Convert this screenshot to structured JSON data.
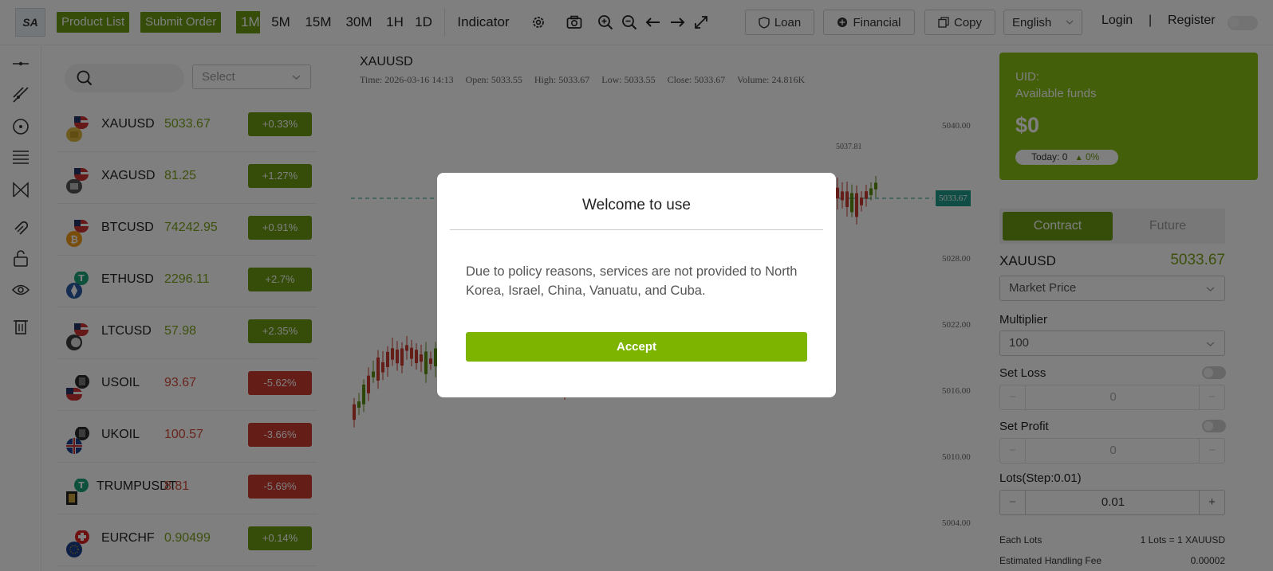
{
  "topbar": {
    "logo": "SA",
    "product_list": "Product List",
    "submit_order": "Submit Order",
    "timeframes": [
      "1M",
      "5M",
      "15M",
      "30M",
      "1H",
      "1D"
    ],
    "active_timeframe": "1M",
    "indicator": "Indicator",
    "loan": "Loan",
    "financial": "Financial",
    "copy": "Copy",
    "language": "English",
    "login": "Login",
    "separator": "|",
    "register": "Register"
  },
  "sidebar": {
    "select_placeholder": "Select",
    "products": [
      {
        "symbol": "XAUUSD",
        "price": "5033.67",
        "change": "+0.33%",
        "trend": "up"
      },
      {
        "symbol": "XAGUSD",
        "price": "81.25",
        "change": "+1.27%",
        "trend": "up"
      },
      {
        "symbol": "BTCUSD",
        "price": "74242.95",
        "change": "+0.91%",
        "trend": "up"
      },
      {
        "symbol": "ETHUSD",
        "price": "2296.11",
        "change": "+2.7%",
        "trend": "up"
      },
      {
        "symbol": "LTCUSD",
        "price": "57.98",
        "change": "+2.35%",
        "trend": "up"
      },
      {
        "symbol": "USOIL",
        "price": "93.67",
        "change": "-5.62%",
        "trend": "down"
      },
      {
        "symbol": "UKOIL",
        "price": "100.57",
        "change": "-3.66%",
        "trend": "down"
      },
      {
        "symbol": "TRUMPUSDT",
        "price": "8.81",
        "change": "-5.69%",
        "trend": "down"
      },
      {
        "symbol": "EURCHF",
        "price": "0.90499",
        "change": "+0.14%",
        "trend": "up"
      }
    ]
  },
  "chart": {
    "symbol": "XAUUSD",
    "info": {
      "time": "Time: 2026-03-16 14:13",
      "open": "Open: 5033.55",
      "high": "High: 5033.67",
      "low": "Low: 5033.55",
      "close": "Close: 5033.67",
      "volume": "Volume: 24.816K"
    },
    "y_ticks": [
      "5040.00",
      "5028.00",
      "5022.00",
      "5016.00",
      "5010.00",
      "5004.00"
    ],
    "current_price_label": "5033.67",
    "high_marker": "5037.81"
  },
  "account": {
    "uid": "UID:",
    "funds_label": "Available funds",
    "funds_value": "$0",
    "today_label": "Today: 0",
    "today_pct": "0%"
  },
  "order_form": {
    "tabs": [
      "Contract",
      "Future"
    ],
    "active_tab": "Contract",
    "symbol": "XAUUSD",
    "price": "5033.67",
    "price_type": "Market Price",
    "multiplier_label": "Multiplier",
    "multiplier_value": "100",
    "set_loss_label": "Set Loss",
    "set_loss_value": "0",
    "set_profit_label": "Set Profit",
    "set_profit_value": "0",
    "lots_label": "Lots(Step:0.01)",
    "lots_value": "0.01",
    "each_lots_label": "Each Lots",
    "each_lots_value": "1 Lots = 1 XAUUSD",
    "fee_label": "Estimated Handling Fee",
    "fee_value": "0.00002"
  },
  "modal": {
    "title": "Welcome to use",
    "message": "Due to policy reasons, services are not provided to North Korea, Israel, China, Vanuatu, and Cuba.",
    "accept": "Accept"
  },
  "colors": {
    "brand_green": "#6a9a12",
    "accept_green": "#7cb400",
    "up": "#6a9a12",
    "down": "#c93a2e",
    "price_up": "#7aa31a",
    "price_down": "#d24a3a",
    "price_tag": "#1e9a8a"
  }
}
